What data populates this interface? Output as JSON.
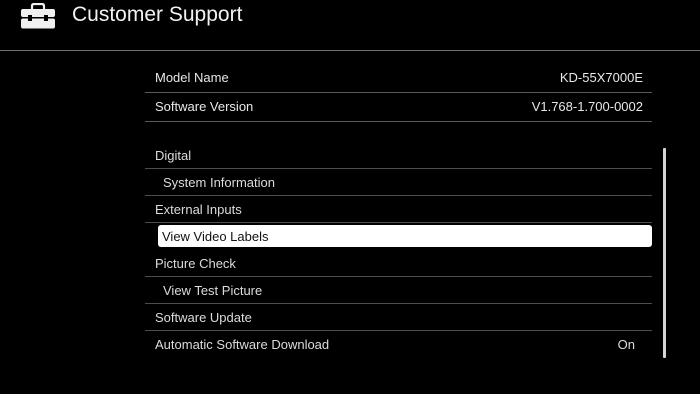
{
  "header": {
    "title": "Customer Support",
    "icon": "toolbox-icon"
  },
  "info": [
    {
      "label": "Model Name",
      "value": "KD-55X7000E"
    },
    {
      "label": "Software Version",
      "value": "V1.768-1.700-0002"
    }
  ],
  "menu": [
    {
      "label": "Digital",
      "level": 0
    },
    {
      "label": "System Information",
      "level": 1
    },
    {
      "label": "External Inputs",
      "level": 0
    },
    {
      "label": "View Video Labels",
      "level": 1,
      "selected": true
    },
    {
      "label": "Picture Check",
      "level": 0
    },
    {
      "label": "View Test Picture",
      "level": 1
    },
    {
      "label": "Software Update",
      "level": 0
    },
    {
      "label": "Automatic Software Download",
      "level": 0,
      "value": "On"
    }
  ],
  "colors": {
    "background": "#000000",
    "text": "#e8e8e8",
    "selected_bg": "#ffffff",
    "selected_text": "#111111",
    "divider": "#5a5a5a"
  }
}
